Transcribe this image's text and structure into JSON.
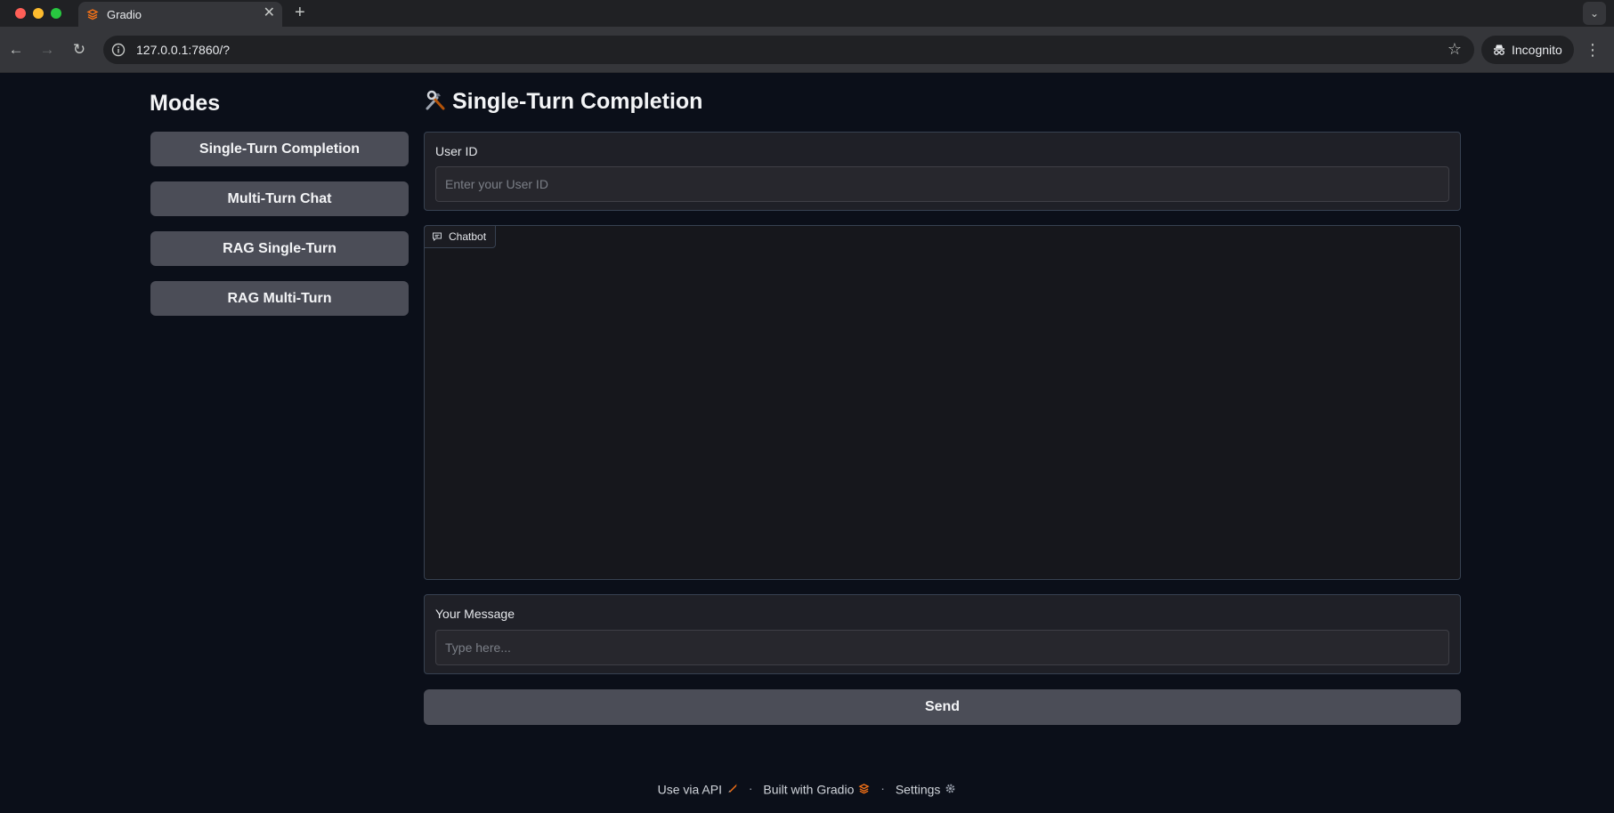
{
  "browser": {
    "tab_title": "Gradio",
    "new_tab_label": "+",
    "url": "127.0.0.1:7860/?",
    "incognito_label": "Incognito"
  },
  "sidebar": {
    "title": "Modes",
    "buttons": [
      {
        "label": "Single-Turn Completion"
      },
      {
        "label": "Multi-Turn Chat"
      },
      {
        "label": "RAG Single-Turn"
      },
      {
        "label": "RAG Multi-Turn"
      }
    ]
  },
  "main": {
    "title": "Single-Turn Completion",
    "title_icon": "hammer-and-wrench-icon",
    "user_id": {
      "label": "User ID",
      "placeholder": "Enter your User ID",
      "value": ""
    },
    "chatbot": {
      "label": "Chatbot",
      "messages": []
    },
    "message": {
      "label": "Your Message",
      "placeholder": "Type here...",
      "value": ""
    },
    "send_label": "Send"
  },
  "footer": {
    "api_label": "Use via API",
    "built_label": "Built with Gradio",
    "settings_label": "Settings",
    "separator": "·"
  },
  "colors": {
    "background": "#0b0f19",
    "button": "#4b4d57",
    "accent_orange": "#f97316"
  }
}
